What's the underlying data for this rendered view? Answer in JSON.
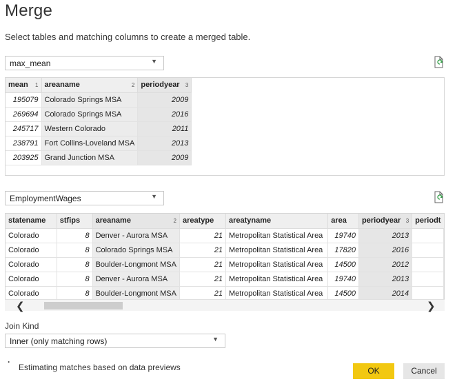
{
  "dialog": {
    "title": "Merge",
    "subtitle": "Select tables and matching columns to create a merged table."
  },
  "table1": {
    "select_value": "max_mean",
    "columns": [
      {
        "name": "mean",
        "index": "1"
      },
      {
        "name": "areaname",
        "index": "2"
      },
      {
        "name": "periodyear",
        "index": "3"
      }
    ],
    "rows": [
      [
        "195079",
        "Colorado Springs MSA",
        "2009"
      ],
      [
        "269694",
        "Colorado Springs MSA",
        "2016"
      ],
      [
        "245717",
        "Western Colorado",
        "2011"
      ],
      [
        "238791",
        "Fort Collins-Loveland MSA",
        "2013"
      ],
      [
        "203925",
        "Grand Junction MSA",
        "2009"
      ]
    ]
  },
  "table2": {
    "select_value": "EmploymentWages",
    "columns": [
      {
        "name": "statename",
        "index": ""
      },
      {
        "name": "stfips",
        "index": ""
      },
      {
        "name": "areaname",
        "index": "2"
      },
      {
        "name": "areatype",
        "index": ""
      },
      {
        "name": "areatyname",
        "index": ""
      },
      {
        "name": "area",
        "index": ""
      },
      {
        "name": "periodyear",
        "index": "3"
      },
      {
        "name": "periodt",
        "index": ""
      }
    ],
    "rows": [
      [
        "Colorado",
        "8",
        "Denver - Aurora MSA",
        "21",
        "Metropolitan Statistical Area",
        "19740",
        "2013",
        ""
      ],
      [
        "Colorado",
        "8",
        "Colorado Springs MSA",
        "21",
        "Metropolitan Statistical Area",
        "17820",
        "2016",
        ""
      ],
      [
        "Colorado",
        "8",
        "Boulder-Longmont MSA",
        "21",
        "Metropolitan Statistical Area",
        "14500",
        "2012",
        ""
      ],
      [
        "Colorado",
        "8",
        "Denver - Aurora MSA",
        "21",
        "Metropolitan Statistical Area",
        "19740",
        "2013",
        ""
      ],
      [
        "Colorado",
        "8",
        "Boulder-Longmont MSA",
        "21",
        "Metropolitan Statistical Area",
        "14500",
        "2014",
        ""
      ]
    ]
  },
  "join_kind": {
    "label": "Join Kind",
    "value": "Inner (only matching rows)"
  },
  "status": {
    "bullet": "·",
    "text": "Estimating matches based on data previews"
  },
  "buttons": {
    "ok": "OK",
    "cancel": "Cancel"
  },
  "scrollbar": {
    "left_arrow": "❮",
    "right_arrow": "❯"
  },
  "colors": {
    "accent": "#f2c811",
    "selected_column": "#e6e6e6"
  }
}
